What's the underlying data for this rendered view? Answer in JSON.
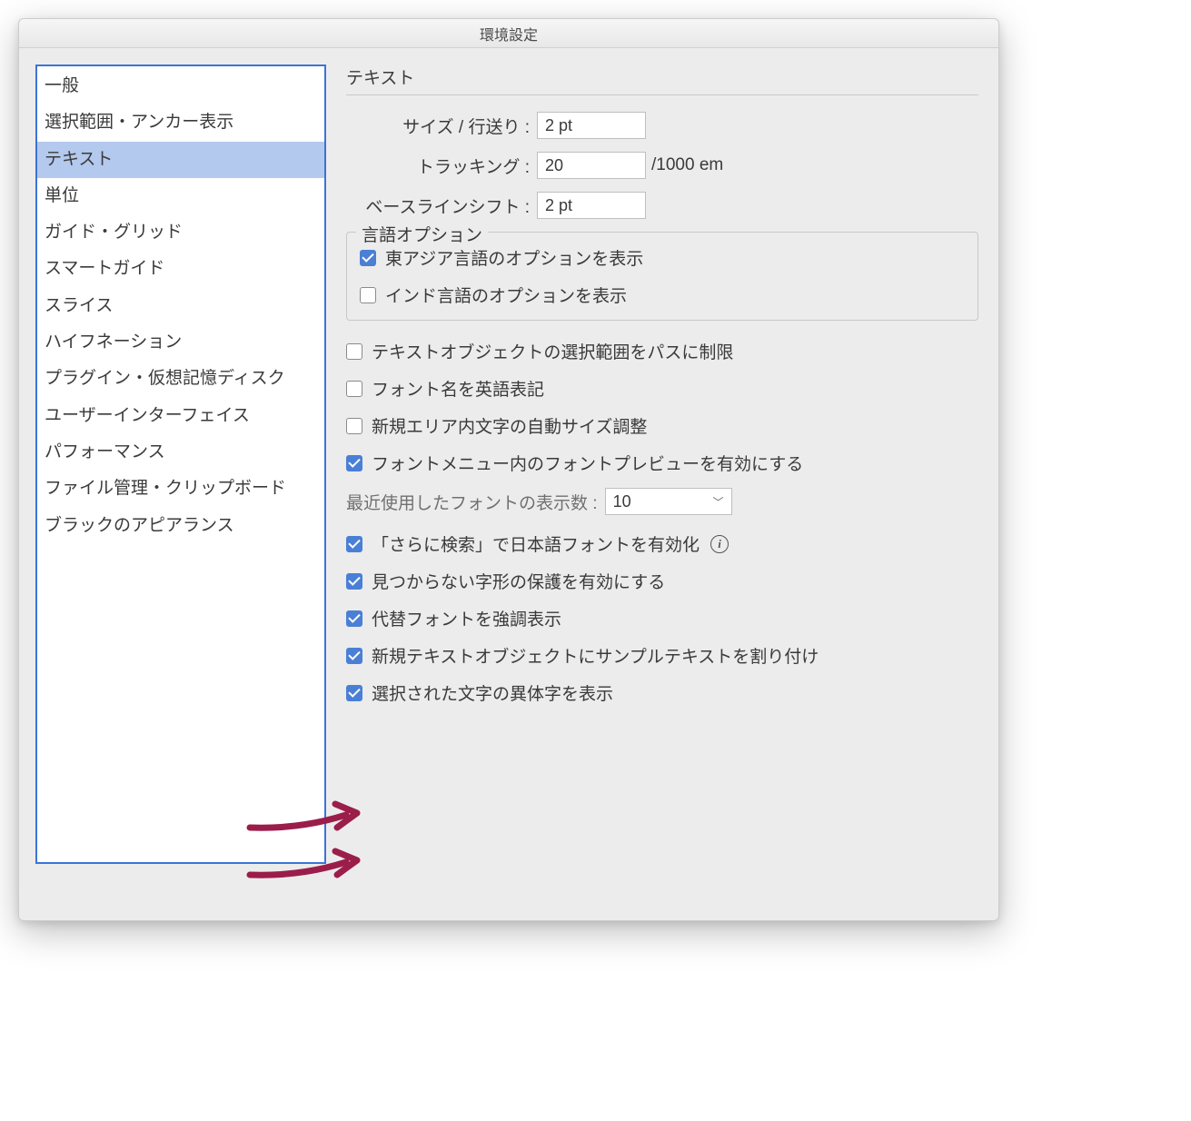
{
  "window": {
    "title": "環境設定"
  },
  "sidebar": {
    "items": [
      {
        "label": "一般",
        "selected": false
      },
      {
        "label": "選択範囲・アンカー表示",
        "selected": false
      },
      {
        "label": "テキスト",
        "selected": true
      },
      {
        "label": "単位",
        "selected": false
      },
      {
        "label": "ガイド・グリッド",
        "selected": false
      },
      {
        "label": "スマートガイド",
        "selected": false
      },
      {
        "label": "スライス",
        "selected": false
      },
      {
        "label": "ハイフネーション",
        "selected": false
      },
      {
        "label": "プラグイン・仮想記憶ディスク",
        "selected": false
      },
      {
        "label": "ユーザーインターフェイス",
        "selected": false
      },
      {
        "label": "パフォーマンス",
        "selected": false
      },
      {
        "label": "ファイル管理・クリップボード",
        "selected": false
      },
      {
        "label": "ブラックのアピアランス",
        "selected": false
      }
    ]
  },
  "main": {
    "section_title": "テキスト",
    "size_leading": {
      "label": "サイズ / 行送り :",
      "value": "2 pt"
    },
    "tracking": {
      "label": "トラッキング :",
      "value": "20",
      "suffix": "/1000 em"
    },
    "baseline_shift": {
      "label": "ベースラインシフト :",
      "value": "2 pt"
    },
    "language_options": {
      "legend": "言語オプション",
      "east_asian": {
        "label": "東アジア言語のオプションを表示",
        "checked": true
      },
      "indic": {
        "label": "インド言語のオプションを表示",
        "checked": false
      }
    },
    "checks": {
      "restrict_selection": {
        "label": "テキストオブジェクトの選択範囲をパスに制限",
        "checked": false
      },
      "english_font_names": {
        "label": "フォント名を英語表記",
        "checked": false
      },
      "auto_size_area": {
        "label": "新規エリア内文字の自動サイズ調整",
        "checked": false
      },
      "font_preview": {
        "label": "フォントメニュー内のフォントプレビューを有効にする",
        "checked": true
      },
      "find_more_jp": {
        "label": "「さらに検索」で日本語フォントを有効化",
        "checked": true
      },
      "missing_glyph": {
        "label": "見つからない字形の保護を有効にする",
        "checked": true
      },
      "highlight_sub": {
        "label": "代替フォントを強調表示",
        "checked": true
      },
      "fill_sample": {
        "label": "新規テキストオブジェクトにサンプルテキストを割り付け",
        "checked": true
      },
      "show_variants": {
        "label": "選択された文字の異体字を表示",
        "checked": true
      }
    },
    "recent_fonts": {
      "label": "最近使用したフォントの表示数 :",
      "value": "10"
    }
  }
}
